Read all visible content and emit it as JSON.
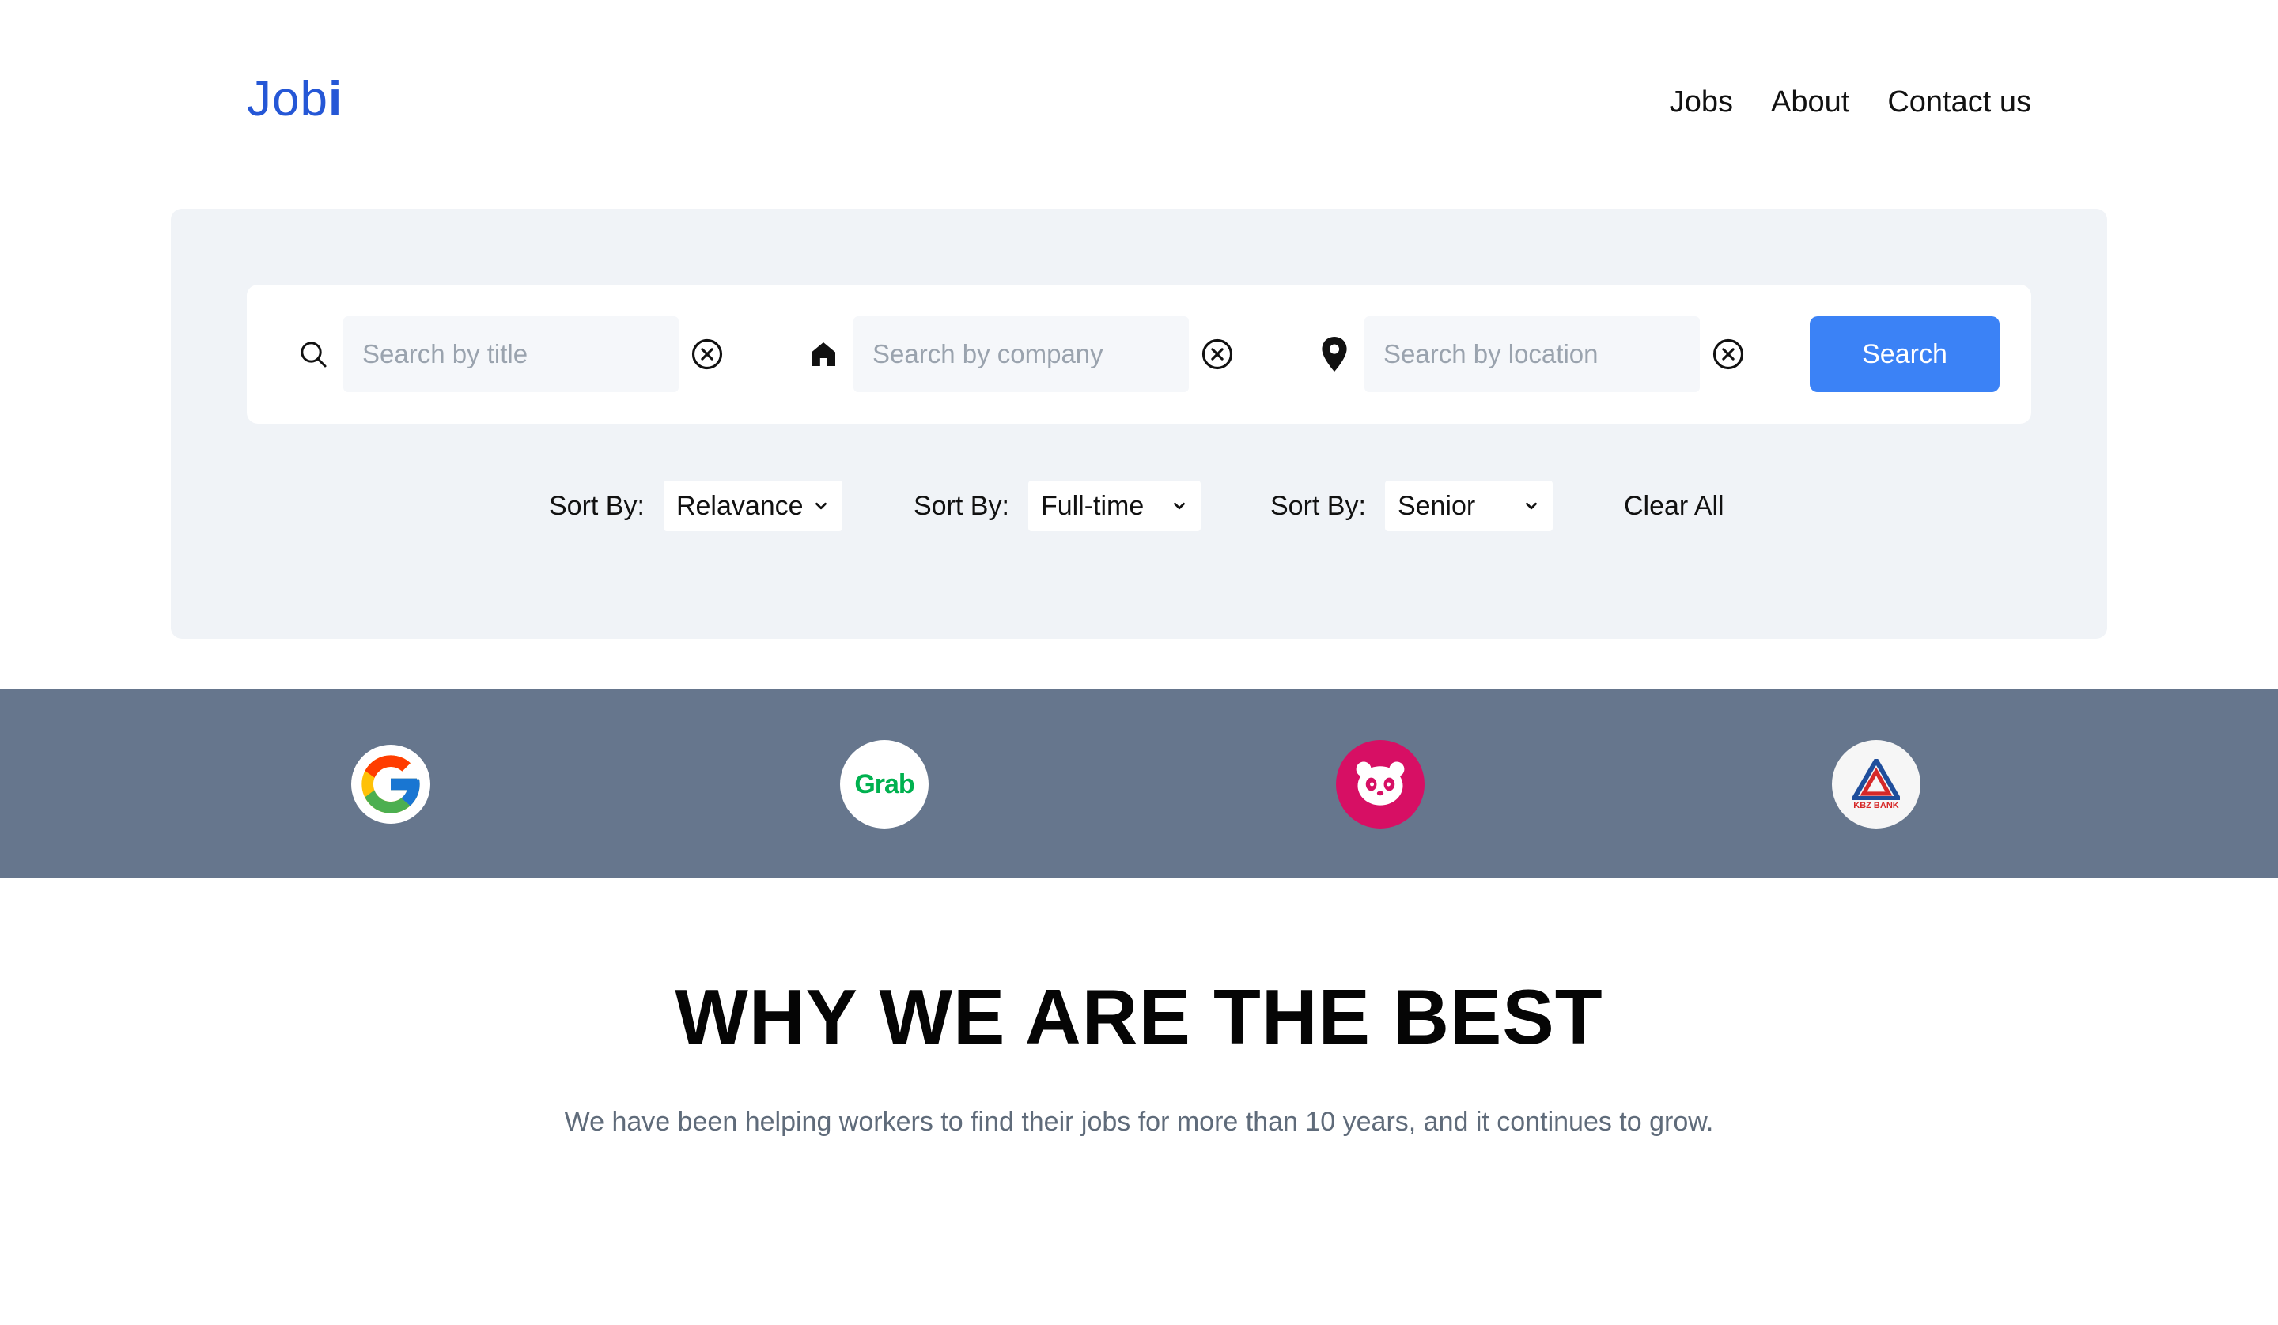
{
  "header": {
    "logo_main": "Job",
    "logo_accent": "i",
    "nav": [
      "Jobs",
      "About",
      "Contact us"
    ]
  },
  "search": {
    "title_placeholder": "Search by title",
    "company_placeholder": "Search by company",
    "location_placeholder": "Search by location",
    "button_label": "Search",
    "icons": {
      "title": "search-icon",
      "company": "home-icon",
      "location": "map-pin-icon",
      "clear": "close-circle-icon"
    }
  },
  "sort": {
    "label": "Sort By:",
    "relevance": "Relavance",
    "type": "Full-time",
    "level": "Senior",
    "clear_all": "Clear All"
  },
  "brands": [
    {
      "name": "Google",
      "icon": "google-logo"
    },
    {
      "name": "Grab",
      "icon": "grab-logo",
      "text": "Grab"
    },
    {
      "name": "foodpanda",
      "icon": "foodpanda-logo"
    },
    {
      "name": "KBZ Bank",
      "icon": "kbz-bank-logo",
      "text": "KBZ BANK"
    }
  ],
  "why": {
    "title": "WHY WE ARE THE BEST",
    "subtitle": "We have been helping workers to find their jobs for more than 10 years, and it continues to grow."
  },
  "colors": {
    "brand_blue": "#2557d6",
    "button_blue": "#3b82f6",
    "panel_bg": "#f0f3f7",
    "strip_bg": "#66768d",
    "foodpanda_pink": "#d70f64",
    "grab_green": "#00b14f"
  }
}
